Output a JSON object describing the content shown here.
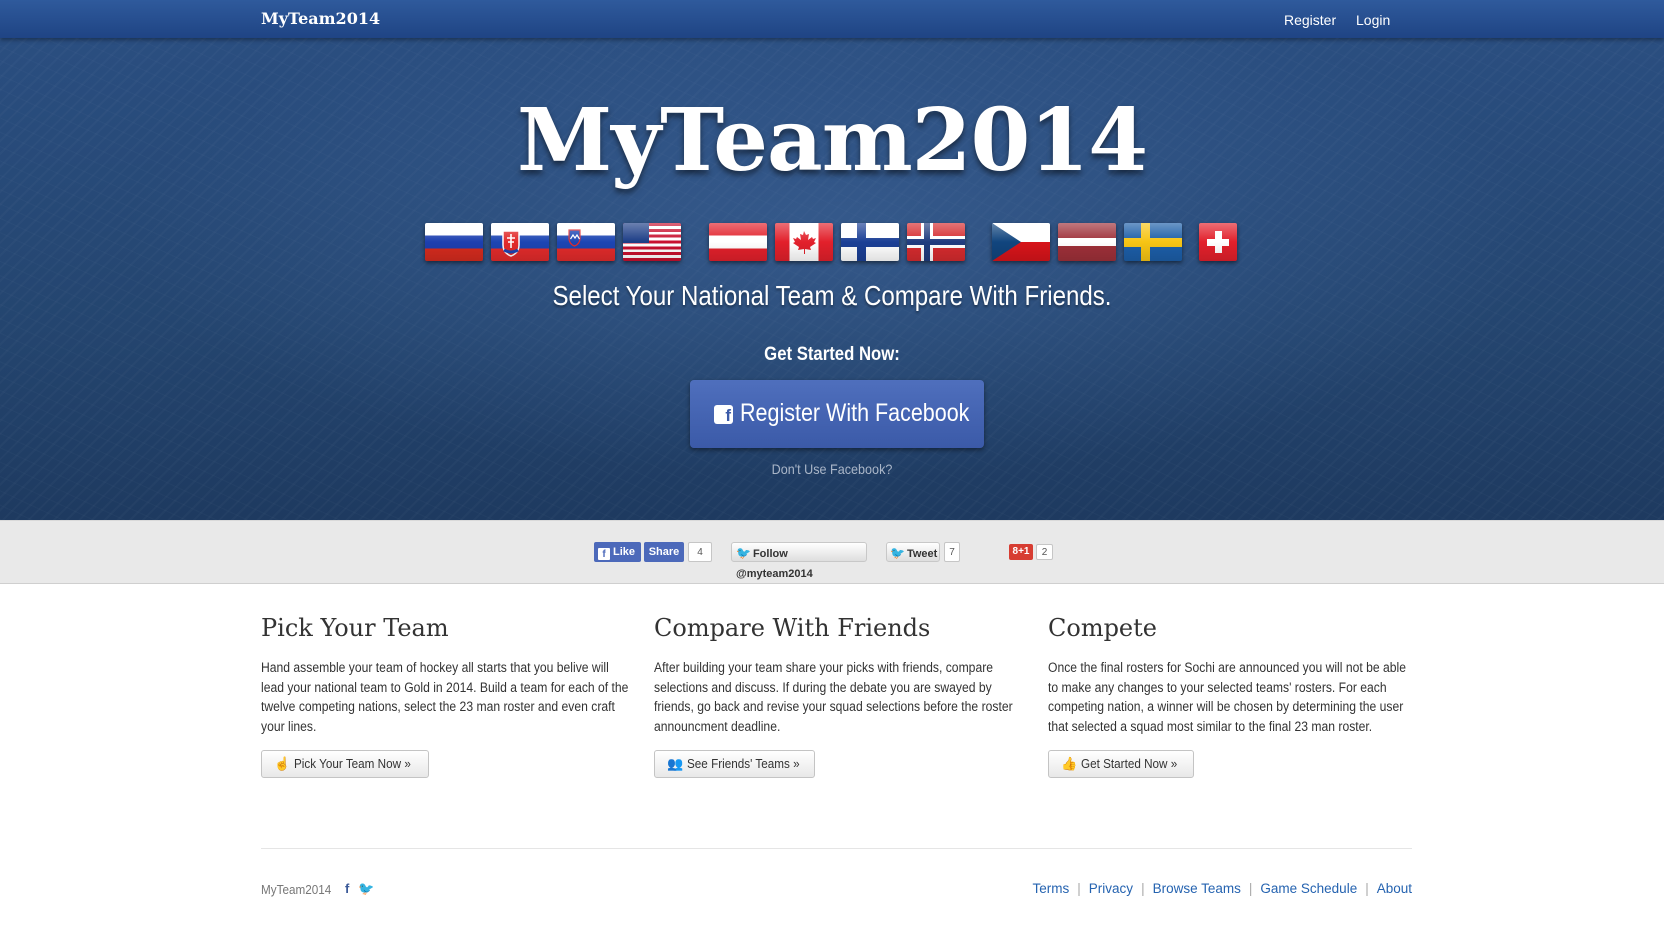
{
  "navbar": {
    "brand": "MyTeam2014",
    "register": "Register",
    "login": "Login"
  },
  "hero": {
    "title": "MyTeam2014",
    "tagline": "Select Your National Team & Compare With Friends.",
    "cta_label": "Get Started Now:",
    "facebook_button": "Register With Facebook",
    "alt_link": "Don't Use Facebook?",
    "flags": [
      "russia-flag",
      "slovakia-flag",
      "slovenia-flag",
      "usa-flag",
      "austria-flag",
      "canada-flag",
      "finland-flag",
      "norway-flag",
      "czech-republic-flag",
      "latvia-flag",
      "sweden-flag",
      "switzerland-flag"
    ]
  },
  "social": {
    "like": "Like",
    "share": "Share",
    "share_count": "4",
    "follow": "Follow @myteam2014",
    "tweet": "Tweet",
    "tweet_count": "7",
    "gplus": "8+1",
    "gplus_count": "2"
  },
  "features": [
    {
      "title": "Pick Your Team",
      "text": "Hand assemble your team of hockey all starts that you belive will lead your national team to Gold in 2014. Build a team for each of the twelve competing nations, select the 23 man roster and even craft your lines.",
      "button": "Pick Your Team Now »",
      "icon": "hand-pointer-icon"
    },
    {
      "title": "Compare With Friends",
      "text": "After building your team share your picks with friends, compare selections and discuss. If during the debate you are swayed by friends, go back and revise your squad selections before the roster announcment deadline.",
      "button": "See Friends' Teams »",
      "icon": "users-icon"
    },
    {
      "title": "Compete",
      "text": "Once the final rosters for Sochi are announced you will not be able to make any changes to your selected teams' rosters. For each competing nation, a winner will be chosen by determining the user that selected a squad most similar to the final 23 man roster.",
      "button": "Get Started Now »",
      "icon": "thumbs-up-icon"
    }
  ],
  "footer": {
    "brand": "MyTeam2014",
    "links": [
      "Terms",
      "Privacy",
      "Browse Teams",
      "Game Schedule",
      "About"
    ]
  }
}
